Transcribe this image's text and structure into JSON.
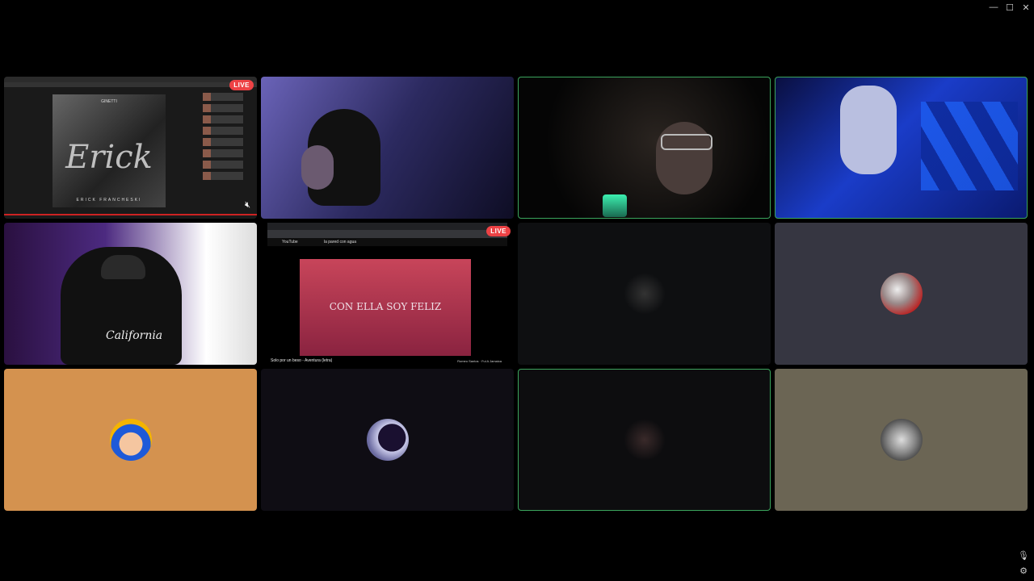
{
  "window": {
    "minimize": "—",
    "maximize": "☐",
    "close": "✕"
  },
  "tiles": [
    {
      "type": "screen-share",
      "live": "LIVE",
      "album": {
        "brand": "GINETTI",
        "artist": "Erick",
        "subtitle": "ERICK FRANCHESKI"
      },
      "muted_icon": "speaker-muted-icon"
    },
    {
      "type": "camera"
    },
    {
      "type": "camera",
      "speaking": true
    },
    {
      "type": "camera",
      "speaking": true
    },
    {
      "type": "camera",
      "shirt_text": "California"
    },
    {
      "type": "screen-share",
      "live": "LIVE",
      "youtube": {
        "logo": "YouTube",
        "search": "la pared con agua",
        "lyric": "CON ELLA SOY FELIZ",
        "title": "Solo por un beso - Aventura (letra)",
        "next": "Romeo Santos · Fui A Jamaica"
      }
    },
    {
      "type": "avatar",
      "bg": "#0e0f11"
    },
    {
      "type": "avatar",
      "bg": "#363641"
    },
    {
      "type": "avatar",
      "bg": "#d4924f"
    },
    {
      "type": "avatar",
      "bg": "#0f0d14"
    },
    {
      "type": "avatar",
      "bg": "#0d0d0f",
      "speaking": true
    },
    {
      "type": "avatar",
      "bg": "#6b6554"
    }
  ],
  "controls": {
    "mic_icon": "microphone-icon",
    "settings_icon": "settings-icon"
  }
}
